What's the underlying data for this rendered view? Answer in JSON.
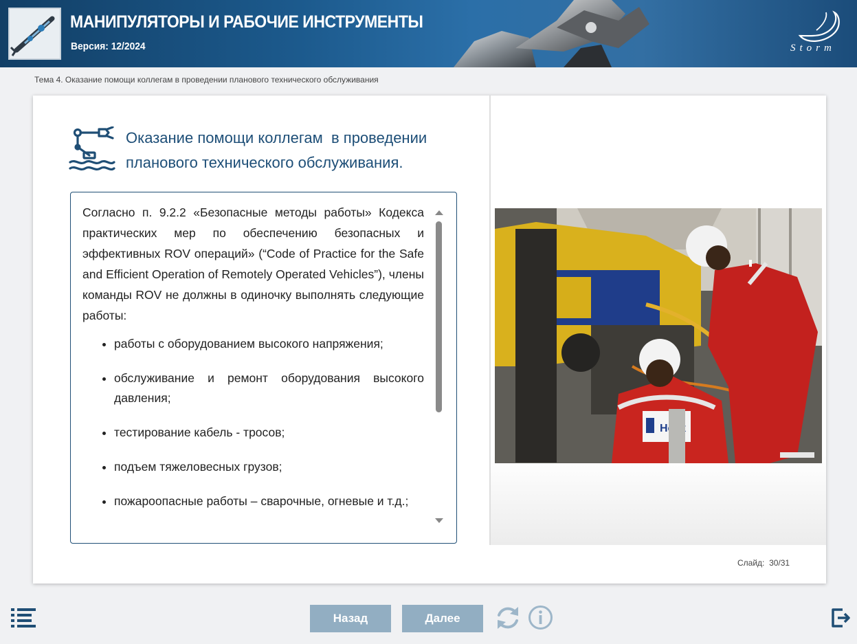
{
  "header": {
    "title": "МАНИПУЛЯТОРЫ И РАБОЧИЕ ИНСТРУМЕНТЫ",
    "version": "Версия: 12/2024",
    "logo_text": "Storm",
    "thumbnail_icon": "rov-manipulator-thumbnail"
  },
  "breadcrumb": "Тема 4. Оказание помощи коллегам в проведении планового технического обслуживания",
  "slide": {
    "title_line1": "Оказание помощи коллегам  в проведении",
    "title_line2": "планового технического обслуживания.",
    "icon": "robot-arm-over-water-icon",
    "paragraph": "Согласно п. 9.2.2 «Безопасные методы работы» Кодекса практических мер по обеспечению безопасных и эффективных ROV операций» (“Code of Practice for the Safe and Efficient Operation of Remotely Operated Vehicles”), члены команды ROV не должны в одиночку выполнять следующие работы:",
    "bullets": [
      "работы с оборудованием высокого напряжения;",
      "обслуживание и ремонт оборудования высокого давления;",
      "тестирование кабель - тросов;",
      "подъем тяжеловесных грузов;",
      "пожароопасные работы – сварочные, огневые и т.д.;"
    ],
    "photo_badge": "Helix",
    "counter_label": "Слайд:",
    "counter_value": "30/31"
  },
  "nav": {
    "back_label": "Назад",
    "next_label": "Далее"
  },
  "colors": {
    "header_blue": "#1c5a8d",
    "title_blue": "#1d4e77",
    "button_bg": "#92aec2",
    "icon_blue": "#1f4e75"
  }
}
